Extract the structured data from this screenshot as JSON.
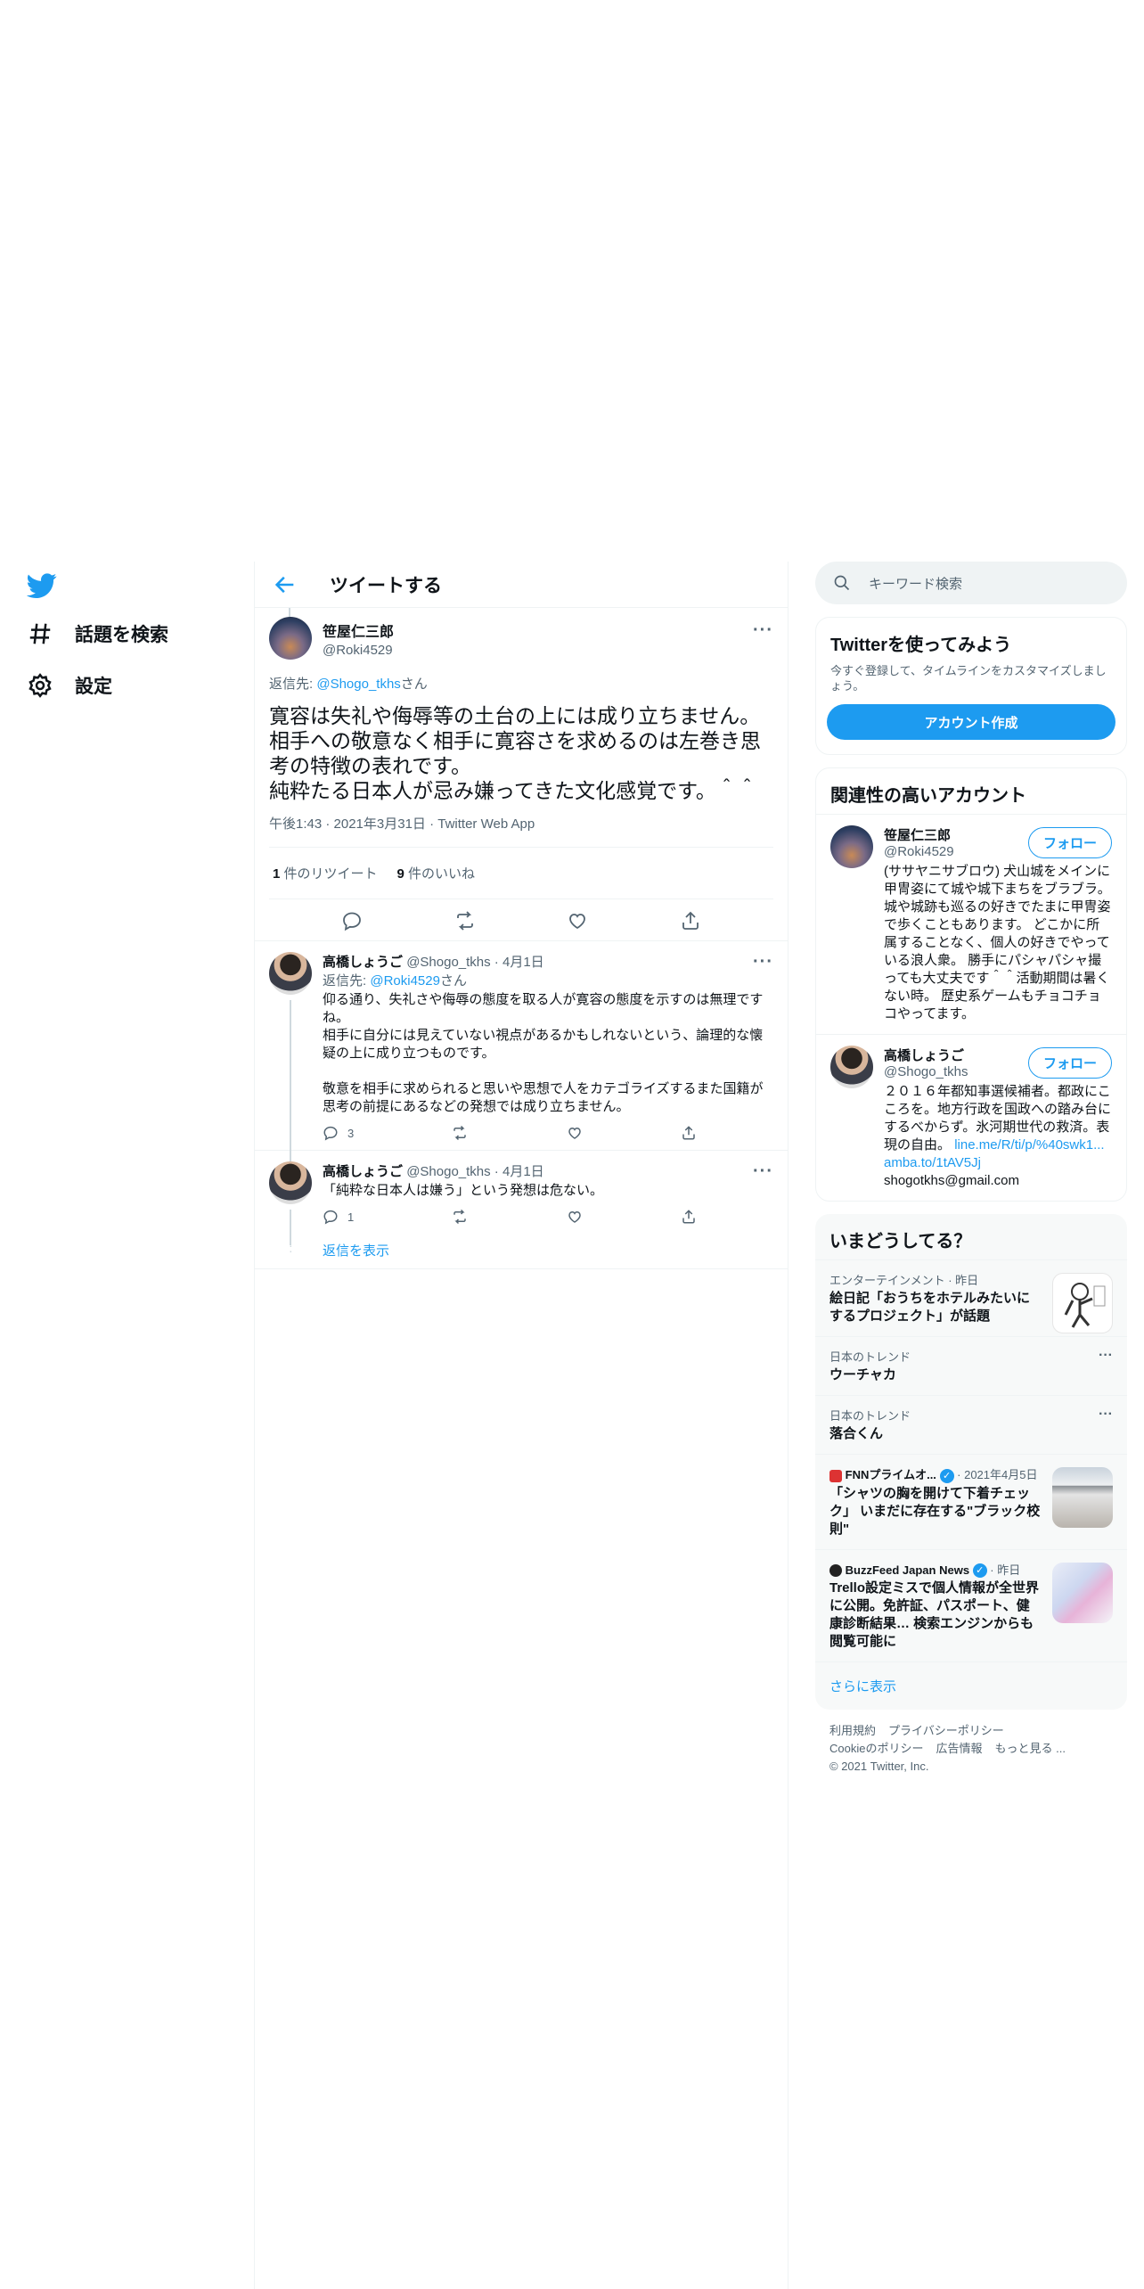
{
  "nav": {
    "logo": "twitter-bird-icon",
    "items": [
      {
        "icon": "hashtag-icon",
        "label": "話題を検索"
      },
      {
        "icon": "gear-icon",
        "label": "設定"
      }
    ]
  },
  "header": {
    "title": "ツイートする"
  },
  "main_tweet": {
    "name": "笹屋仁三郎",
    "handle": "@Roki4529",
    "reply_prefix": "返信先: ",
    "reply_to": "@Shogo_tkhs",
    "reply_suffix": "さん",
    "text": "寛容は失礼や侮辱等の土台の上には成り立ちません。\n相手への敬意なく相手に寛容さを求めるのは左巻き思考の特徴の表れです。\n純粋たる日本人が忌み嫌ってきた文化感覚です。＾＾",
    "timestamp": "午後1:43 · 2021年3月31日 · Twitter Web App",
    "retweets_count": "1",
    "retweets_label": " 件のリツイート",
    "likes_count": "9",
    "likes_label": " 件のいいね"
  },
  "replies": [
    {
      "name": "高橋しょうご",
      "handle": "@Shogo_tkhs",
      "date": " · 4月1日",
      "reply_prefix": "返信先: ",
      "reply_to": "@Roki4529",
      "reply_suffix": "さん",
      "text": "仰る通り、失礼さや侮辱の態度を取る人が寛容の態度を示すのは無理ですね。\n相手に自分には見えていない視点があるかもしれないという、論理的な懐疑の上に成り立つものです。\n\n敬意を相手に求められると思いや思想で人をカテゴライズするまた国籍が思考の前提にあるなどの発想では成り立ちません。",
      "reply_count": "3"
    },
    {
      "name": "高橋しょうご",
      "handle": "@Shogo_tkhs",
      "date": " · 4月1日",
      "text": "「純粋な日本人は嫌う」という発想は危ない。",
      "reply_count": "1"
    }
  ],
  "show_replies": "返信を表示",
  "search": {
    "placeholder": "キーワード検索"
  },
  "signup": {
    "title": "Twitterを使ってみよう",
    "subtitle": "今すぐ登録して、タイムラインをカスタマイズしましょう。",
    "button": "アカウント作成"
  },
  "related": {
    "title": "関連性の高いアカウント",
    "accounts": [
      {
        "name": "笹屋仁三郎",
        "handle": "@Roki4529",
        "follow": "フォロー",
        "bio": "(ササヤニサブロウ) 犬山城をメインに甲冑姿にて城や城下まちをブラブラ。城や城跡も巡るの好きでたまに甲冑姿で歩くこともあります。 どこかに所属することなく、個人の好きでやっている浪人衆。 勝手にパシャパシャ撮っても大丈夫です＾＾活動期間は暑くない時。 歴史系ゲームもチョコチョコやってます。"
      },
      {
        "name": "高橋しょうご",
        "handle": "@Shogo_tkhs",
        "follow": "フォロー",
        "bio": "２０１６年都知事選候補者。都政にこころを。地方行政を国政への踏み台にするべからず。氷河期世代の救済。表現の自由。",
        "link1": "line.me/R/ti/p/%40swk1...",
        "link2": "amba.to/1tAV5Jj",
        "email": "shogotkhs@gmail.com"
      }
    ]
  },
  "trends": {
    "title": "いまどうしてる？",
    "items": [
      {
        "meta": "エンターテインメント · 昨日",
        "title": "絵日記「おうちをホテルみたいにするプロジェクト」が話題"
      },
      {
        "meta": "日本のトレンド",
        "title": "ウーチャカ"
      },
      {
        "meta": "日本のトレンド",
        "title": "落合くん"
      },
      {
        "source": "FNNプライムオ...",
        "meta": " · 2021年4月5日",
        "title": "「シャツの胸を開けて下着チェック」 いまだに存在する\"ブラック校則\""
      },
      {
        "source": "BuzzFeed Japan News",
        "meta": " · 昨日",
        "title": "Trello設定ミスで個人情報が全世界に公開。免許証、パスポート、健康診断結果… 検索エンジンからも閲覧可能に"
      }
    ],
    "more": "さらに表示"
  },
  "footer": {
    "links": [
      "利用規約",
      "プライバシーポリシー",
      "Cookieのポリシー",
      "広告情報",
      "もっと見る ..."
    ],
    "copyright": "© 2021 Twitter, Inc."
  }
}
